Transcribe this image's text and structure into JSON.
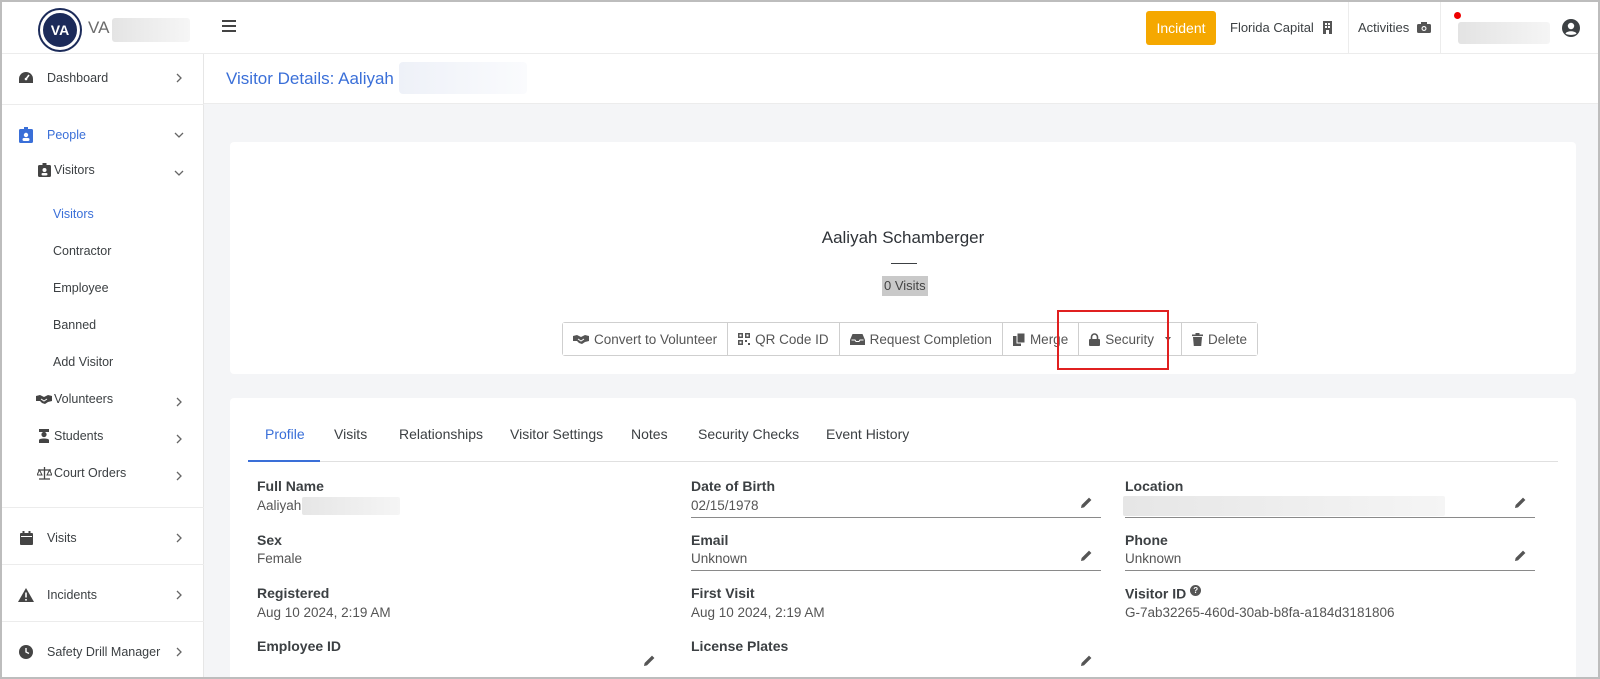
{
  "header": {
    "brand": "VA",
    "incident_button": "Incident",
    "location": "Florida Capital",
    "activities": "Activities"
  },
  "sidebar": {
    "items": [
      {
        "label": "Dashboard"
      },
      {
        "label": "People"
      },
      {
        "label": "Visitors"
      },
      {
        "label": "Visitors"
      },
      {
        "label": "Contractor"
      },
      {
        "label": "Employee"
      },
      {
        "label": "Banned"
      },
      {
        "label": "Add Visitor"
      },
      {
        "label": "Volunteers"
      },
      {
        "label": "Students"
      },
      {
        "label": "Court Orders"
      },
      {
        "label": "Visits"
      },
      {
        "label": "Incidents"
      },
      {
        "label": "Safety Drill Manager"
      }
    ]
  },
  "page": {
    "title": "Visitor Details: Aaliyah"
  },
  "profile": {
    "name": "Aaliyah Schamberger",
    "visits_badge": "0 Visits",
    "actions": [
      {
        "label": "Convert to Volunteer"
      },
      {
        "label": "QR Code ID"
      },
      {
        "label": "Request Completion"
      },
      {
        "label": "Merge"
      },
      {
        "label": "Security"
      },
      {
        "label": "Delete"
      }
    ]
  },
  "tabs": [
    {
      "label": "Profile"
    },
    {
      "label": "Visits"
    },
    {
      "label": "Relationships"
    },
    {
      "label": "Visitor Settings"
    },
    {
      "label": "Notes"
    },
    {
      "label": "Security Checks"
    },
    {
      "label": "Event History"
    }
  ],
  "fields": {
    "full_name": {
      "label": "Full Name",
      "value": "Aaliyah"
    },
    "dob": {
      "label": "Date of Birth",
      "value": "02/15/1978"
    },
    "location": {
      "label": "Location",
      "value": ""
    },
    "sex": {
      "label": "Sex",
      "value": "Female"
    },
    "email": {
      "label": "Email",
      "value": "Unknown"
    },
    "phone": {
      "label": "Phone",
      "value": "Unknown"
    },
    "registered": {
      "label": "Registered",
      "value": "Aug 10 2024, 2:19 AM"
    },
    "first_visit": {
      "label": "First Visit",
      "value": "Aug 10 2024, 2:19 AM"
    },
    "visitor_id": {
      "label": "Visitor ID",
      "value": "G-7ab32265-460d-30ab-b8fa-a184d3181806"
    },
    "employee_id": {
      "label": "Employee ID",
      "value": ""
    },
    "license_plates": {
      "label": "License Plates",
      "value": ""
    }
  },
  "colors": {
    "accent": "#3a6fd8",
    "incident": "#f5a800",
    "highlight": "#e02020",
    "logo": "#1c2b5a"
  }
}
